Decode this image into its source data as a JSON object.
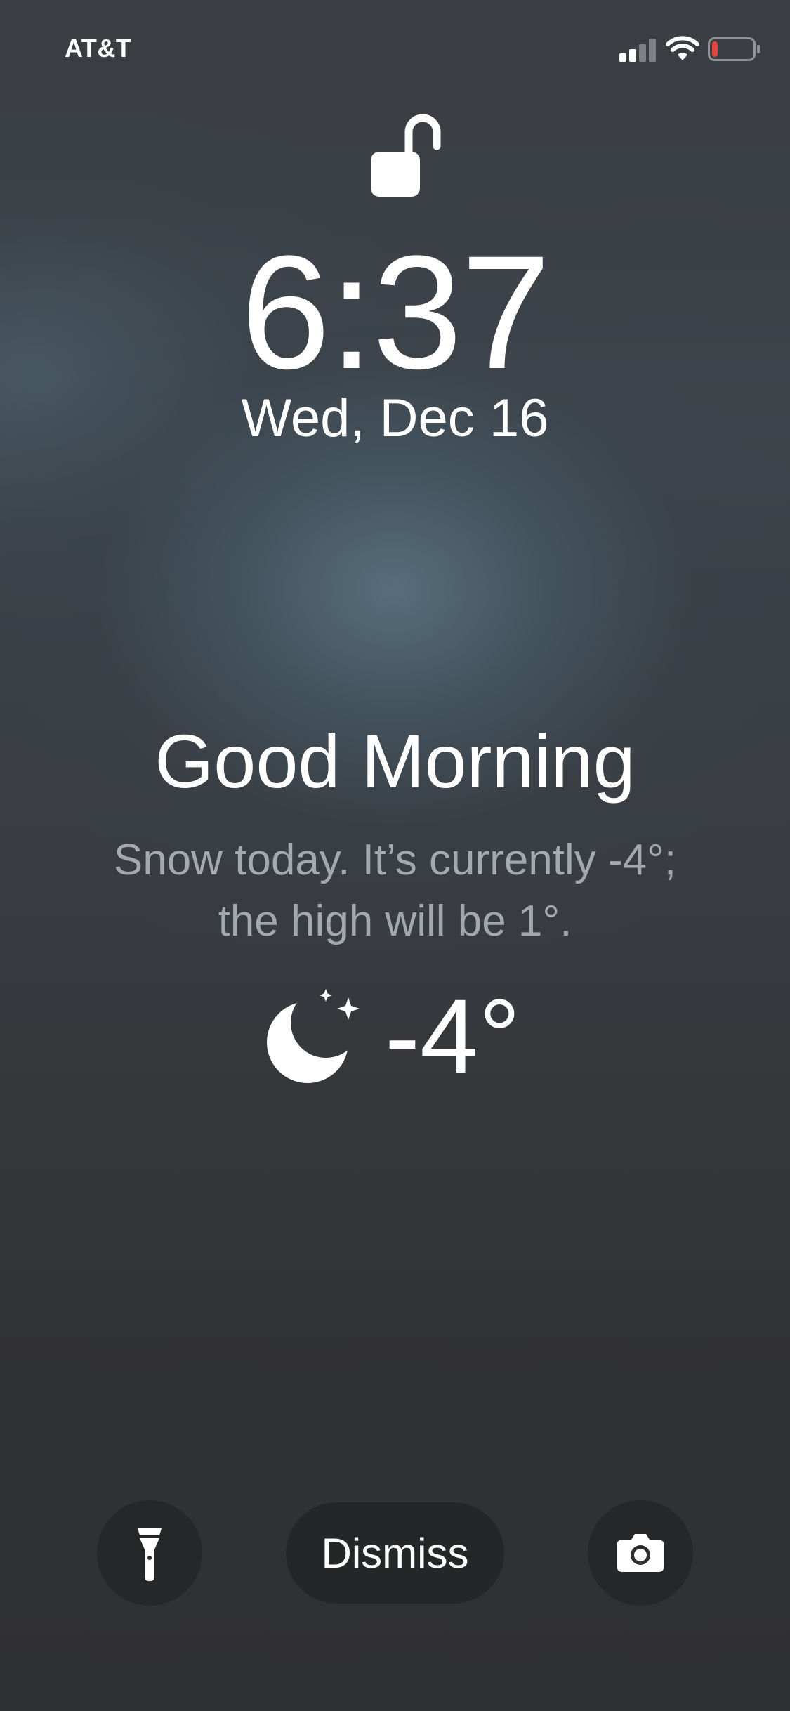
{
  "status_bar": {
    "carrier": "AT&T",
    "signal_bars_active": 2,
    "signal_bars_total": 4,
    "wifi_icon": "wifi-icon",
    "battery_level": 0.1,
    "battery_color": "#e5443d"
  },
  "lock_screen": {
    "lock_icon": "unlocked-padlock-icon",
    "time": "6:37",
    "date": "Wed, Dec 16"
  },
  "greeting": {
    "title": "Good Morning",
    "forecast": "Snow today. It’s currently -4°; the high will be 1°."
  },
  "weather": {
    "icon": "moon-stars-icon",
    "temperature": "-4°"
  },
  "controls": {
    "flashlight_icon": "flashlight-icon",
    "dismiss_label": "Dismiss",
    "camera_icon": "camera-icon"
  },
  "colors": {
    "foreground": "#ffffff",
    "secondary_text": "#cdd2d8",
    "button_background": "#1e1f21"
  }
}
